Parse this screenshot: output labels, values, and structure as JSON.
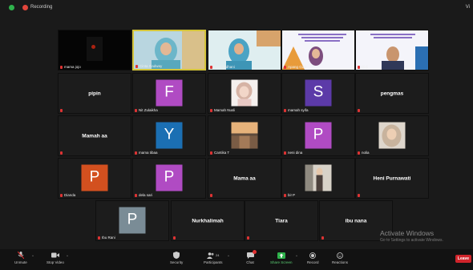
{
  "topbar": {
    "recording_label": "Recording",
    "view_label": "Vi"
  },
  "tiles": [
    {
      "key": "t1",
      "name": "mama jojo",
      "center": "",
      "avatar_letter": "",
      "avatar_color": "",
      "kind": "video-dark"
    },
    {
      "key": "t2",
      "name": "Cinta Gadway",
      "center": "",
      "avatar_letter": "",
      "avatar_color": "",
      "kind": "video-person",
      "active": true
    },
    {
      "key": "t3",
      "name": "Devi Erdhani",
      "center": "",
      "avatar_letter": "",
      "avatar_color": "",
      "kind": "video-person2"
    },
    {
      "key": "t4",
      "name": "Apang Gdd",
      "center": "",
      "avatar_letter": "",
      "avatar_color": "",
      "kind": "video-slide"
    },
    {
      "key": "t5",
      "name": "Didi",
      "center": "",
      "avatar_letter": "",
      "avatar_color": "",
      "kind": "video-slide-man"
    },
    {
      "key": "t6",
      "name": "",
      "center": "pipin",
      "avatar_letter": "",
      "avatar_color": "",
      "kind": "text"
    },
    {
      "key": "t7",
      "name": "Nit Zulaikha",
      "center": "",
      "avatar_letter": "F",
      "avatar_color": "#b04bc3",
      "kind": "avatar"
    },
    {
      "key": "t8",
      "name": "Mamah Nusli",
      "center": "",
      "avatar_letter": "",
      "avatar_color": "",
      "kind": "photo-girl"
    },
    {
      "key": "t9",
      "name": "mamah syifa",
      "center": "",
      "avatar_letter": "S",
      "avatar_color": "#5c3aa8",
      "kind": "avatar"
    },
    {
      "key": "t10",
      "name": "",
      "center": "pengmas",
      "avatar_letter": "",
      "avatar_color": "",
      "kind": "text"
    },
    {
      "key": "t11",
      "name": "",
      "center": "Mamah aa",
      "avatar_letter": "",
      "avatar_color": "",
      "kind": "text"
    },
    {
      "key": "t12",
      "name": "mama tibaa",
      "center": "",
      "avatar_letter": "Y",
      "avatar_color": "#1b6fb3",
      "kind": "avatar"
    },
    {
      "key": "t13",
      "name": "Cantika T",
      "center": "",
      "avatar_letter": "",
      "avatar_color": "",
      "kind": "photo-sunset"
    },
    {
      "key": "t14",
      "name": "neni dina",
      "center": "",
      "avatar_letter": "P",
      "avatar_color": "#b04bc3",
      "kind": "avatar"
    },
    {
      "key": "t15",
      "name": "nolia",
      "center": "",
      "avatar_letter": "",
      "avatar_color": "",
      "kind": "photo-hijab"
    },
    {
      "key": "t16",
      "name": "Dianda",
      "center": "",
      "avatar_letter": "P",
      "avatar_color": "#d3501f",
      "kind": "avatar"
    },
    {
      "key": "t17",
      "name": "dela sari",
      "center": "",
      "avatar_letter": "P",
      "avatar_color": "#b04bc3",
      "kind": "avatar"
    },
    {
      "key": "t18",
      "name": "",
      "center": "Mama aa",
      "avatar_letter": "",
      "avatar_color": "",
      "kind": "text"
    },
    {
      "key": "t19",
      "name": "bi! P",
      "center": "",
      "avatar_letter": "",
      "avatar_color": "",
      "kind": "photo-woman"
    },
    {
      "key": "t20",
      "name": "",
      "center": "Heni Purnawati",
      "avatar_letter": "",
      "avatar_color": "",
      "kind": "text"
    },
    {
      "key": "t21",
      "name": "Ibu Rani",
      "center": "",
      "avatar_letter": "P",
      "avatar_color": "#7a8c96",
      "kind": "avatar"
    },
    {
      "key": "t22",
      "name": "",
      "center": "Nurkhalimah",
      "avatar_letter": "",
      "avatar_color": "",
      "kind": "text"
    },
    {
      "key": "t23",
      "name": "",
      "center": "Tiara",
      "avatar_letter": "",
      "avatar_color": "",
      "kind": "text"
    },
    {
      "key": "t24",
      "name": "",
      "center": "ibu nana",
      "avatar_letter": "",
      "avatar_color": "",
      "kind": "text"
    }
  ],
  "watermark": {
    "line1": "Activate Windows",
    "line2": "Go to Settings to activate Windows."
  },
  "toolbar": {
    "unmute": "Unmute",
    "stop_video": "Stop Video",
    "security": "Security",
    "participants": "Participants",
    "participants_count": "24",
    "chat": "Chat",
    "share_screen": "Share Screen",
    "record": "Record",
    "reactions": "Reactions",
    "leave": "Leave"
  },
  "colors": {
    "share_green": "#2fb24c",
    "leave_red": "#d0242b",
    "active_border": "#d4c43a",
    "mic_red": "#dd3333"
  }
}
